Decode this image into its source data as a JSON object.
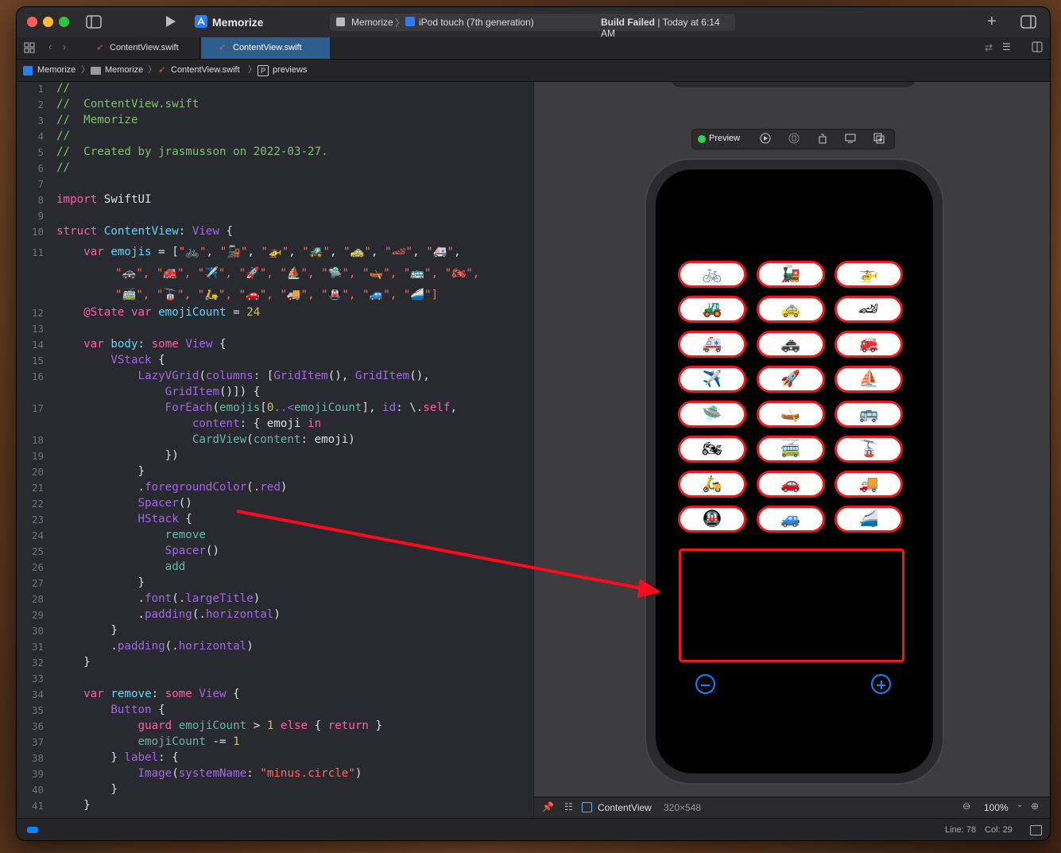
{
  "window": {
    "app_title": "Memorize",
    "scheme": {
      "project": "Memorize",
      "device": "iPod touch (7th generation)"
    },
    "build_status": {
      "bold": "Build Failed",
      "rest": " | Today at 6:14 AM"
    }
  },
  "tabs": [
    {
      "label": "ContentView.swift",
      "active": false
    },
    {
      "label": "ContentView.swift",
      "active": true
    }
  ],
  "breadcrumb": [
    "Memorize",
    "Memorize",
    "ContentView.swift",
    "previews"
  ],
  "line_numbers": [
    "1",
    "2",
    "3",
    "4",
    "5",
    "6",
    "7",
    "8",
    "9",
    "10",
    "11",
    "",
    "",
    "12",
    "13",
    "14",
    "15",
    "16",
    "",
    "17",
    "",
    "18",
    "19",
    "20",
    "21",
    "22",
    "23",
    "24",
    "25",
    "26",
    "27",
    "28",
    "29",
    "30",
    "31",
    "32",
    "33",
    "34",
    "35",
    "36",
    "37",
    "38",
    "39",
    "40",
    "41"
  ],
  "code": {
    "l1": "//",
    "l2": "//  ContentView.swift",
    "l3": "//  Memorize",
    "l4": "//",
    "l5": "//  Created by jrasmusson on 2022-03-27.",
    "l6": "//",
    "l8a": "import",
    "l8b": " SwiftUI",
    "l10a": "struct",
    "l10b": " ContentView",
    "l10c": ": ",
    "l10d": "View",
    "l10e": " {",
    "l11a": "    var",
    "l11b": " emojis",
    "l11c": " = [",
    "l11d": "\"🚲\"",
    "l11e": ", ",
    "l11f": "\"🚂\"",
    "l11g": ", ",
    "l11h": "\"🚁\"",
    "l11i": ", ",
    "l11j": "\"🚜\"",
    "l11k": ", ",
    "l11l": "\"🚕\"",
    "l11m": ", ",
    "l11n": "\"🏎\"",
    "l11o": ", ",
    "l11p": "\"🚑\"",
    "l11q": ",",
    "l11w2": "\"🚓\", \"🚒\", \"✈️\", \"🚀\", \"⛵️\", \"🛸\", \"🛶\", \"🚌\", \"🏍\",",
    "l11w3": "\"🚎\", \"🚡\", \"🛵\", \"🚗\", \"🚚\", \"🚇\", \"🚙\", \"🚄\"]",
    "l12a": "    @State",
    "l12b": " var",
    "l12c": " emojiCount",
    "l12d": " = ",
    "l12e": "24",
    "l14a": "    var",
    "l14b": " body",
    "l14c": ": ",
    "l14d": "some",
    "l14e": " View",
    "l14f": " {",
    "l15a": "        VStack",
    "l15b": " {",
    "l16a": "            LazyVGrid",
    "l16b": "(",
    "l16c": "columns",
    "l16d": ": [",
    "l16e": "GridItem",
    "l16f": "(), ",
    "l16g": "GridItem",
    "l16h": "(),",
    "l16w2a": "                GridItem",
    "l16w2b": "()]) {",
    "l17a": "                ForEach",
    "l17b": "(",
    "l17c": "emojis",
    "l17d": "[",
    "l17e": "0",
    "l17f": "..<",
    "l17g": "emojiCount",
    "l17h": "], ",
    "l17i": "id",
    "l17j": ": \\.",
    "l17k": "self",
    "l17l": ",",
    "l17w2a": "                    content",
    "l17w2b": ": { emoji ",
    "l17w2c": "in",
    "l18a": "                    CardView",
    "l18b": "(",
    "l18c": "content",
    "l18d": ": emoji)",
    "l19": "                })",
    "l20": "            }",
    "l21a": "            .",
    "l21b": "foregroundColor",
    "l21c": "(.",
    "l21d": "red",
    "l21e": ")",
    "l22a": "            Spacer",
    "l22b": "()",
    "l23a": "            HStack",
    "l23b": " {",
    "l24": "                remove",
    "l25a": "                Spacer",
    "l25b": "()",
    "l26": "                add",
    "l27": "            }",
    "l28a": "            .",
    "l28b": "font",
    "l28c": "(.",
    "l28d": "largeTitle",
    "l28e": ")",
    "l29a": "            .",
    "l29b": "padding",
    "l29c": "(.",
    "l29d": "horizontal",
    "l29e": ")",
    "l30": "        }",
    "l31a": "        .",
    "l31b": "padding",
    "l31c": "(.",
    "l31d": "horizontal",
    "l31e": ")",
    "l32": "    }",
    "l34a": "    var",
    "l34b": " remove",
    "l34c": ": ",
    "l34d": "some",
    "l34e": " View",
    "l34f": " {",
    "l35a": "        Button",
    "l35b": " {",
    "l36a": "            guard",
    "l36b": " emojiCount",
    "l36c": " > ",
    "l36d": "1",
    "l36e": " else",
    "l36f": " { ",
    "l36g": "return",
    "l36h": " }",
    "l37a": "            emojiCount",
    "l37b": " -= ",
    "l37c": "1",
    "l38a": "        } ",
    "l38b": "label",
    "l38c": ": {",
    "l39a": "            Image",
    "l39b": "(",
    "l39c": "systemName",
    "l39d": ": ",
    "l39e": "\"minus.circle\"",
    "l39f": ")",
    "l40": "        }",
    "l41": "    }"
  },
  "preview": {
    "label": "Preview",
    "cards": [
      "🚲",
      "🚂",
      "🚁",
      "🚜",
      "🚕",
      "🏎",
      "🚑",
      "🚓",
      "🚒",
      "✈️",
      "🚀",
      "⛵️",
      "🛸",
      "🛶",
      "🚌",
      "🏍",
      "🚎",
      "🚡",
      "🛵",
      "🚗",
      "🚚",
      "🚇",
      "🚙",
      "🚄"
    ],
    "view_name": "ContentView",
    "view_size": "320×548",
    "zoom": "100%"
  },
  "status": {
    "line": "Line: 78",
    "col": "Col: 29"
  },
  "colors": {
    "accent": "#0a84ff",
    "card_border": "#f0171b",
    "arrow": "#ff0a1a"
  }
}
